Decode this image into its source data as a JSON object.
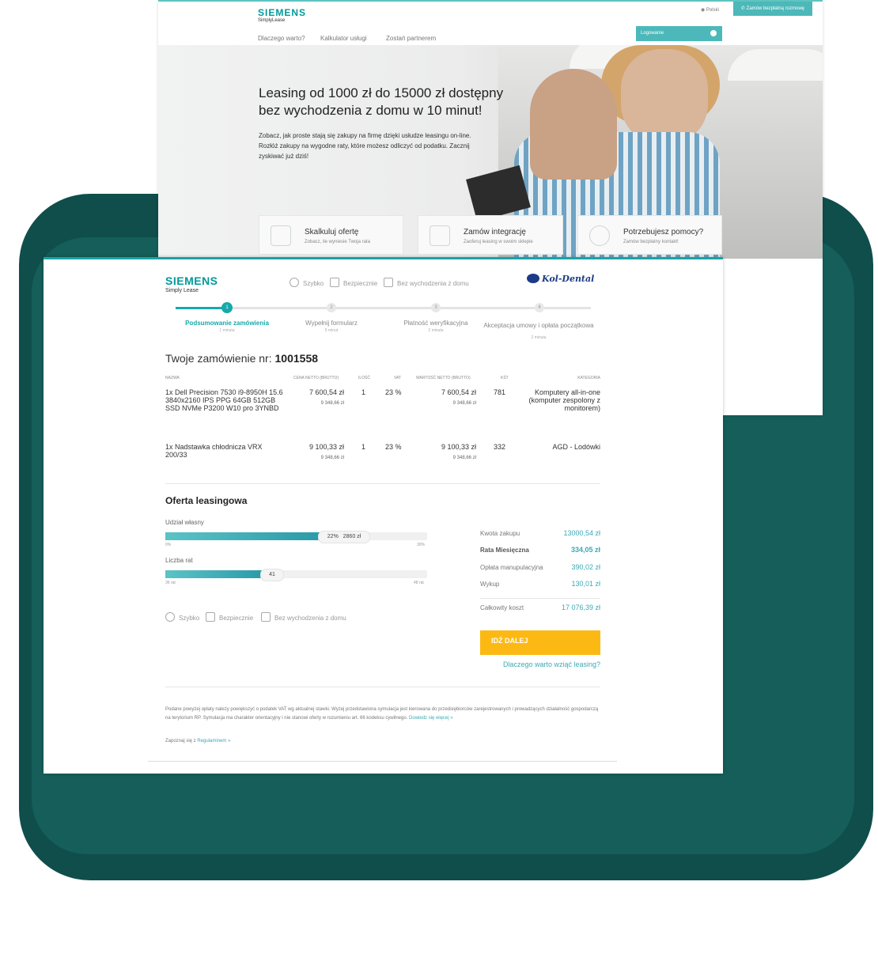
{
  "back": {
    "logo": "SIEMENS",
    "logo_sub": "SimplyLease",
    "nav": [
      "Dlaczego warto?",
      "Kalkulator usługi",
      "Zostań partnerem"
    ],
    "lang": "Polski",
    "cta": "Zamów bezpłatną rozmowę",
    "login": "Logowanie",
    "hero_title": "Leasing od 1000 zł do 15000 zł dostępny bez wychodzenia z domu w 10 minut!",
    "hero_text": "Zobacz, jak proste stają się zakupy na firmę dzięki usłudze leasingu on-line. Rozłóż zakupy na wygodne raty, które możesz odliczyć od podatku. Zacznij zyskiwać już dziś!",
    "cards": [
      {
        "title": "Skalkuluj ofertę",
        "sub": "Zobacz, ile wyniesie Twoja rata",
        "icon": "sliders-icon"
      },
      {
        "title": "Zamów integrację",
        "sub": "Zaoferuj leasing w swoim sklepie",
        "icon": "screens-icon"
      },
      {
        "title": "Potrzebujesz pomocy?",
        "sub": "Zamów bezpłatny kontakt!",
        "icon": "headset-icon"
      }
    ]
  },
  "front": {
    "logo": "SIEMENS",
    "logo_sub": "Simply Lease",
    "features": [
      "Szybko",
      "Bezpiecznie",
      "Bez wychodzenia z domu"
    ],
    "partner": "Kol-Dental",
    "steps": [
      {
        "num": "1",
        "label": "Podsumowanie zamówienia",
        "meta": "1 minuta"
      },
      {
        "num": "2",
        "label": "Wypełnij formularz",
        "meta": "5 minut"
      },
      {
        "num": "3",
        "label": "Płatność weryfikacyjna",
        "meta": "2 minuta"
      },
      {
        "num": "4",
        "label": "Akceptacja umowy i opłata początkowa",
        "meta": "2 minuta"
      }
    ],
    "order_label": "Twoje zamówienie nr:",
    "order_number": "1001558",
    "columns": [
      "Nazwa",
      "Cena netto (brutto)",
      "Ilość",
      "VAT",
      "Wartość netto (brutto)",
      "KŚT",
      "Kategoria"
    ],
    "rows": [
      {
        "name": "1x Dell Precision 7530 i9-8950H 15.6 3840x2160 IPS PPG 64GB 512GB SSD NVMe P3200 W10 pro 3YNBD",
        "price": "7 600,54 zł",
        "price_gross": "9 348,66 zł",
        "qty": "1",
        "vat": "23 %",
        "value": "7 600,54 zł",
        "value_gross": "9 348,66 zł",
        "kst": "781",
        "category": "Komputery all-in-one (komputer zespolony z monitorem)"
      },
      {
        "name": "1x Nadstawka chłodnicza VRX 200/33",
        "price": "9 100,33 zł",
        "price_gross": "9 348,66 zł",
        "qty": "1",
        "vat": "23 %",
        "value": "9 100,33 zł",
        "value_gross": "9 348,66 zł",
        "kst": "332",
        "category": "AGD - Lodówki"
      }
    ],
    "offer_title": "Oferta leasingowa",
    "down_payment": {
      "label": "Udział własny",
      "percent": "22%",
      "amount": "2860 zł",
      "fill": 0.6,
      "min": "0%",
      "max": "30%"
    },
    "installments": {
      "label": "Liczba rat",
      "value": "41",
      "fill": 0.38,
      "min": "36 rat",
      "max": "48 rat"
    },
    "summary": [
      {
        "label": "Kwota zakupu",
        "value": "13000,54 zł"
      },
      {
        "label": "Rata Miesięczna",
        "value": "334,05 zł"
      },
      {
        "label": "Opłata manupulacyjna",
        "value": "390,02 zł"
      },
      {
        "label": "Wykup",
        "value": "130,01 zł"
      },
      {
        "label": "Całkowity koszt",
        "value": "17 076,39 zł"
      }
    ],
    "go_button": "IDŹ DALEJ",
    "why_link": "Dlaczego warto wziąć leasing?",
    "disclaimer": "Podane powyżej opłaty należy powiększyć o podatek VAT wg aktualnej stawki. Wyżej przedstawiona symulacja jest kierowana do przedsiębiorców zarejestrowanych i prowadzących działalność gospodarczą na terytorium RP. Symulacja ma charakter orientacyjny i nie stanowi oferty w rozumieniu art. 66 kodeksu cywilnego.",
    "disclaimer_link": "Dowiedz się więcej »",
    "reg_text": "Zapoznaj się z",
    "reg_link": "Regulaminem »"
  },
  "colors": {
    "teal": "#17a9a9",
    "yellow": "#fdb913",
    "dark_bg": "#0f4e4b"
  }
}
